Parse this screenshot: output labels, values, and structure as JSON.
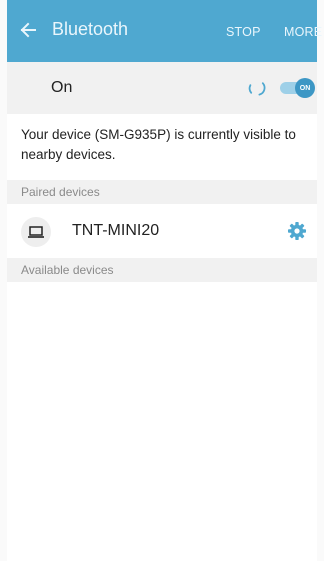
{
  "appbar": {
    "title": "Bluetooth",
    "stop_label": "STOP",
    "more_label": "MORE",
    "back_icon": "arrow-left-icon",
    "color": "#4fa8d0"
  },
  "master_switch": {
    "label": "On",
    "toggle_text": "ON",
    "state": "on",
    "scanning": true,
    "accent": "#3d97c5"
  },
  "visibility_message": "Your device (SM-G935P) is currently visible to nearby devices.",
  "paired": {
    "header": "Paired devices",
    "devices": [
      {
        "name": "TNT-MINI20",
        "icon": "laptop-icon",
        "settings_icon": "gear-icon"
      }
    ]
  },
  "available": {
    "header": "Available devices"
  }
}
